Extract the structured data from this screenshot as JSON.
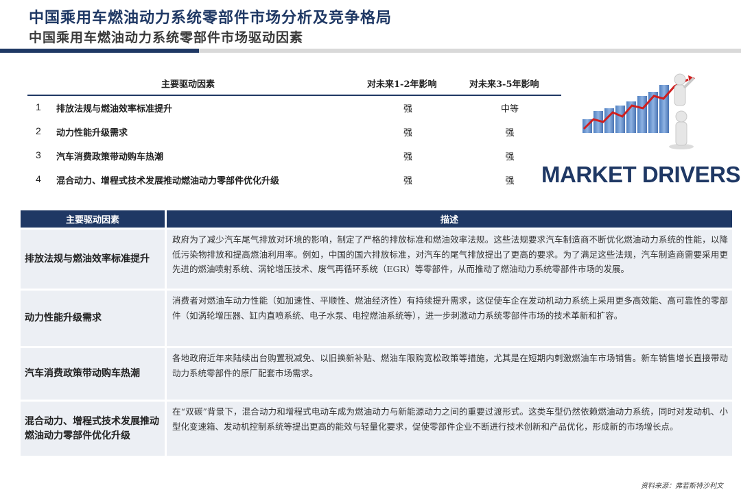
{
  "header": {
    "title": "中国乘用车燃油动力系统零部件市场分析及竞争格局",
    "subtitle": "中国乘用车燃油动力系统零部件市场驱动因素"
  },
  "summary": {
    "columns": [
      "主要驱动因素",
      "对未来1-2年影响",
      "对未来3-5年影响"
    ],
    "rows": [
      {
        "idx": "1",
        "name": "排放法规与燃油效率标准提升",
        "short": "强",
        "long": "中等"
      },
      {
        "idx": "2",
        "name": "动力性能升级需求",
        "short": "强",
        "long": "强"
      },
      {
        "idx": "3",
        "name": "汽车消费政策带动购车热潮",
        "short": "强",
        "long": "强"
      },
      {
        "idx": "4",
        "name": "混合动力、增程式技术发展推动燃油动力零部件优化升级",
        "short": "强",
        "long": "强"
      }
    ]
  },
  "image": {
    "caption": "MARKET DRIVERS",
    "colors": {
      "bars": "#6f98cf",
      "arrow": "#d01f1f",
      "text": "#1f3864"
    }
  },
  "detail": {
    "columns": [
      "主要驱动因素",
      "描述"
    ],
    "rows": [
      {
        "factor": "排放法规与燃油效率标准提升",
        "description": "政府为了减少汽车尾气排放对环境的影响，制定了严格的排放标准和燃油效率法规。这些法规要求汽车制造商不断优化燃油动力系统的性能，以降低污染物排放和提高燃油利用率。例如，中国的国六排放标准，对汽车的尾气排放提出了更高的要求。为了满足这些法规，汽车制造商需要采用更先进的燃油喷射系统、涡轮增压技术、废气再循环系统（EGR）等零部件，从而推动了燃油动力系统零部件市场的发展。"
      },
      {
        "factor": "动力性能升级需求",
        "description": "消费者对燃油车动力性能（如加速性、平顺性、燃油经济性）有持续提升需求，这促使车企在发动机动力系统上采用更多高效能、高可靠性的零部件（如涡轮增压器、缸内直喷系统、电子水泵、电控燃油系统等），进一步刺激动力系统零部件市场的技术革新和扩容。"
      },
      {
        "factor": "汽车消费政策带动购车热潮",
        "description": "各地政府近年来陆续出台购置税减免、以旧换新补贴、燃油车限购宽松政策等措施，尤其是在短期内刺激燃油车市场销售。新车销售增长直接带动动力系统零部件的原厂配套市场需求。"
      },
      {
        "factor": "混合动力、增程式技术发展推动燃油动力零部件优化升级",
        "description": "在“双碳”背景下，混合动力和增程式电动车成为燃油动力与新能源动力之间的重要过渡形式。这类车型仍然依赖燃油动力系统，同时对发动机、小型化变速箱、发动机控制系统等提出更高的能效与轻量化要求，促使零部件企业不断进行技术创新和产品优化，形成新的市场增长点。"
      }
    ]
  },
  "footer": {
    "source": "资料来源：弗若斯特沙利文"
  },
  "colors": {
    "brand": "#1f3864",
    "cell_bg": "#eceff4",
    "rule_gray": "#d9d9d9"
  }
}
